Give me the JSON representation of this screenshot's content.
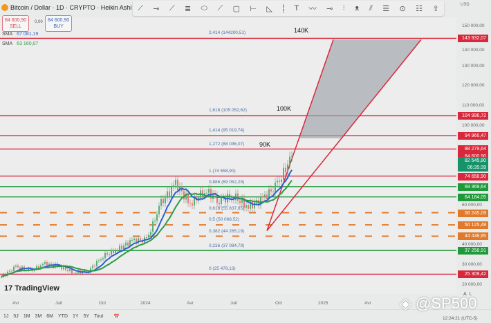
{
  "header": {
    "title": "Bitcoin / Dollar · 1D · CRYPTO · Heikin Ashi",
    "sell_price": "84 600,90",
    "sell_label": "SELL",
    "buy_price": "84 600,90",
    "buy_label": "BUY",
    "spread": "0,00"
  },
  "indicators": [
    {
      "name": "SMA",
      "value": "67 081,19",
      "color": "#3a66c8"
    },
    {
      "name": "SMA",
      "value": "63 160,07",
      "color": "#2e9a48"
    }
  ],
  "toolbar": {
    "icons": [
      "trend-line",
      "horizontal-ray",
      "ray",
      "parallel-channel",
      "ellipse",
      "brush",
      "rectangle",
      "date-range",
      "triangle",
      "vertical-line",
      "text",
      "path",
      "arrow-marker",
      "long-position",
      "pattern",
      "pen",
      "fib-channel",
      "circle",
      "regression",
      "arrow-up"
    ],
    "glyphs": [
      "⟋",
      "⊸",
      "⟋",
      "≣",
      "⬭",
      "⟋",
      "▢",
      "⊢",
      "◺",
      "⸽",
      "T",
      "〰",
      "⊸",
      "⫶",
      "ᴥ",
      "⫽",
      "☰",
      "⊙",
      "☷",
      "⇧"
    ]
  },
  "price_axis": {
    "currency": "USD",
    "labels": [
      "150 000,00",
      "140 000,00",
      "130 000,00",
      "120 000,00",
      "110 000,00",
      "100 000,00",
      "60 000,00",
      "40 000,00",
      "30 000,00",
      "20 000,00"
    ]
  },
  "price_tags": [
    {
      "text": "143 932,07",
      "color": "#d9283c"
    },
    {
      "text": "104 996,72",
      "color": "#d9283c"
    },
    {
      "text": "94 966,47",
      "color": "#d9283c"
    },
    {
      "text": "88 279,64",
      "color": "#d9283c"
    },
    {
      "text": "84 600,90",
      "color": "#d9283c"
    },
    {
      "text": "82 545,80",
      "color": "#17936a"
    },
    {
      "text": "06:35:39",
      "color": "#17936a"
    },
    {
      "text": "74 658,90",
      "color": "#d9283c"
    },
    {
      "text": "69 369,64",
      "color": "#1f9a3a"
    },
    {
      "text": "64 184,05",
      "color": "#1f9a3a"
    },
    {
      "text": "56 245,09",
      "color": "#e0792a"
    },
    {
      "text": "50 125,48",
      "color": "#e0792a"
    },
    {
      "text": "44 438,95",
      "color": "#e0792a"
    },
    {
      "text": "37 258,91",
      "color": "#1f9a3a"
    },
    {
      "text": "25 309,42",
      "color": "#d9283c"
    }
  ],
  "fib_labels": [
    "2,414 (144200,51)",
    "1,618 (105 052,62)",
    "1,414 (95 019,74)",
    "1,272 (88 036,07)",
    "1 (74 658,90)",
    "0,886 (69 052,29)",
    "0,618 (55 837,85)",
    "0,5 (50 068,52)",
    "0,382 (44 265,19)",
    "0,236 (37 084,79)",
    "0 (25 478,13)"
  ],
  "annotations": [
    "140K",
    "100K",
    "90K"
  ],
  "time_axis": [
    "Avr",
    "Juil",
    "Oct",
    "2024",
    "Avr",
    "Juil",
    "Oct",
    "2025",
    "Avr"
  ],
  "ranges": [
    "1J",
    "5J",
    "1M",
    "3M",
    "6M",
    "YTD",
    "1Y",
    "5Y",
    "Tout"
  ],
  "axis_buttons": [
    "A",
    "L"
  ],
  "brand": "TradingView",
  "watermark": "@SP500",
  "clock": "12:24:21 (UTC-5)",
  "chart_data": {
    "type": "candlestick",
    "title": "Bitcoin / Dollar · 1D · CRYPTO · Heikin Ashi",
    "ylim": [
      20000,
      150000
    ],
    "x": [
      "2023-03",
      "2023-04",
      "2023-05",
      "2023-06",
      "2023-07",
      "2023-08",
      "2023-09",
      "2023-10",
      "2023-11",
      "2023-12",
      "2024-01",
      "2024-02",
      "2024-03",
      "2024-04",
      "2024-05",
      "2024-06",
      "2024-07",
      "2024-08",
      "2024-09",
      "2024-10",
      "2024-11"
    ],
    "close": [
      24000,
      29000,
      27000,
      30500,
      29200,
      26000,
      27000,
      34500,
      37700,
      42300,
      42500,
      61000,
      71000,
      60600,
      67500,
      62700,
      64600,
      59000,
      63300,
      70200,
      84600
    ],
    "levels": [
      {
        "price": 143932.07,
        "color": "#d9283c",
        "style": "solid"
      },
      {
        "price": 104996.72,
        "color": "#d9283c",
        "style": "solid"
      },
      {
        "price": 94966.47,
        "color": "#d9283c",
        "style": "solid"
      },
      {
        "price": 88279.64,
        "color": "#d9283c",
        "style": "solid"
      },
      {
        "price": 74658.9,
        "color": "#d9283c",
        "style": "solid"
      },
      {
        "price": 69369.64,
        "color": "#1f9a3a",
        "style": "solid"
      },
      {
        "price": 64184.05,
        "color": "#1f9a3a",
        "style": "solid"
      },
      {
        "price": 56245.09,
        "color": "#e0792a",
        "style": "dashed"
      },
      {
        "price": 50125.48,
        "color": "#e0792a",
        "style": "dashed"
      },
      {
        "price": 44438.95,
        "color": "#e0792a",
        "style": "dashed"
      },
      {
        "price": 37258.91,
        "color": "#1f9a3a",
        "style": "solid"
      },
      {
        "price": 25309.42,
        "color": "#d9283c",
        "style": "solid"
      }
    ],
    "triangle": {
      "apex_date": "2024-09",
      "apex_price": 50000,
      "upper_price": 144000,
      "upper_dates": [
        "2025-01",
        "2025-08"
      ]
    }
  }
}
